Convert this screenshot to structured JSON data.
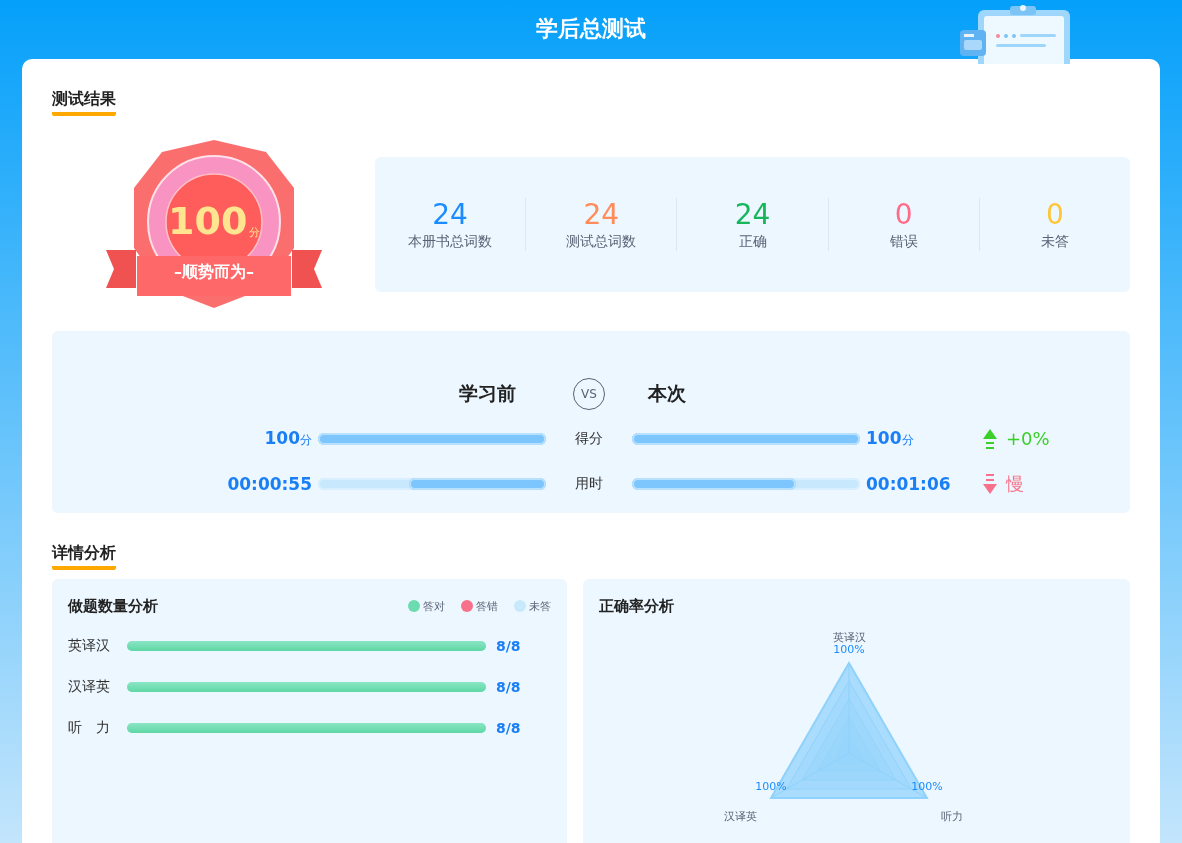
{
  "header": {
    "title": "学后总测试"
  },
  "result": {
    "heading": "测试结果",
    "badge": {
      "score": "100",
      "unit": "分",
      "motto": "–顺势而为–"
    },
    "stats": [
      {
        "value": "24",
        "label": "本册书总词数",
        "color": "#1a8cff"
      },
      {
        "value": "24",
        "label": "测试总词数",
        "color": "#ff8c5a"
      },
      {
        "value": "24",
        "label": "正确",
        "color": "#16b65b"
      },
      {
        "value": "0",
        "label": "错误",
        "color": "#ff6b8a"
      },
      {
        "value": "0",
        "label": "未答",
        "color": "#ffc533"
      }
    ]
  },
  "compare": {
    "before_title": "学习前",
    "vs": "VS",
    "after_title": "本次",
    "rows": [
      {
        "label": "得分",
        "before": {
          "value": "100",
          "unit": "分",
          "level": 1
        },
        "after": {
          "value": "100",
          "unit": "分",
          "level": 1
        },
        "trend": {
          "kind": "up",
          "text": "+0%"
        }
      },
      {
        "label": "用时",
        "before": {
          "value": "00:00:55",
          "level": 0.6
        },
        "after": {
          "value": "00:01:06",
          "level": 0.72
        },
        "trend": {
          "kind": "down",
          "text": "慢"
        }
      }
    ]
  },
  "details": {
    "heading": "详情分析",
    "count_card": {
      "title": "做题数量分析",
      "legend": [
        {
          "label": "答对",
          "color": "#6ddbb0"
        },
        {
          "label": "答错",
          "color": "#f7718a"
        },
        {
          "label": "未答",
          "color": "#c8e8fb"
        }
      ],
      "rows": [
        {
          "label": "英译汉",
          "level": 1,
          "value": "8/8"
        },
        {
          "label": "汉译英",
          "level": 1,
          "value": "8/8"
        },
        {
          "label": "听　力",
          "level": 1,
          "value": "8/8"
        }
      ]
    },
    "accuracy_card": {
      "title": "正确率分析",
      "axes": [
        {
          "label": "英译汉",
          "value_label": "100%",
          "level": 1
        },
        {
          "label": "汉译英",
          "value_label": "100%",
          "level": 1
        },
        {
          "label": "听力",
          "value_label": "100%",
          "level": 1
        }
      ]
    }
  }
}
